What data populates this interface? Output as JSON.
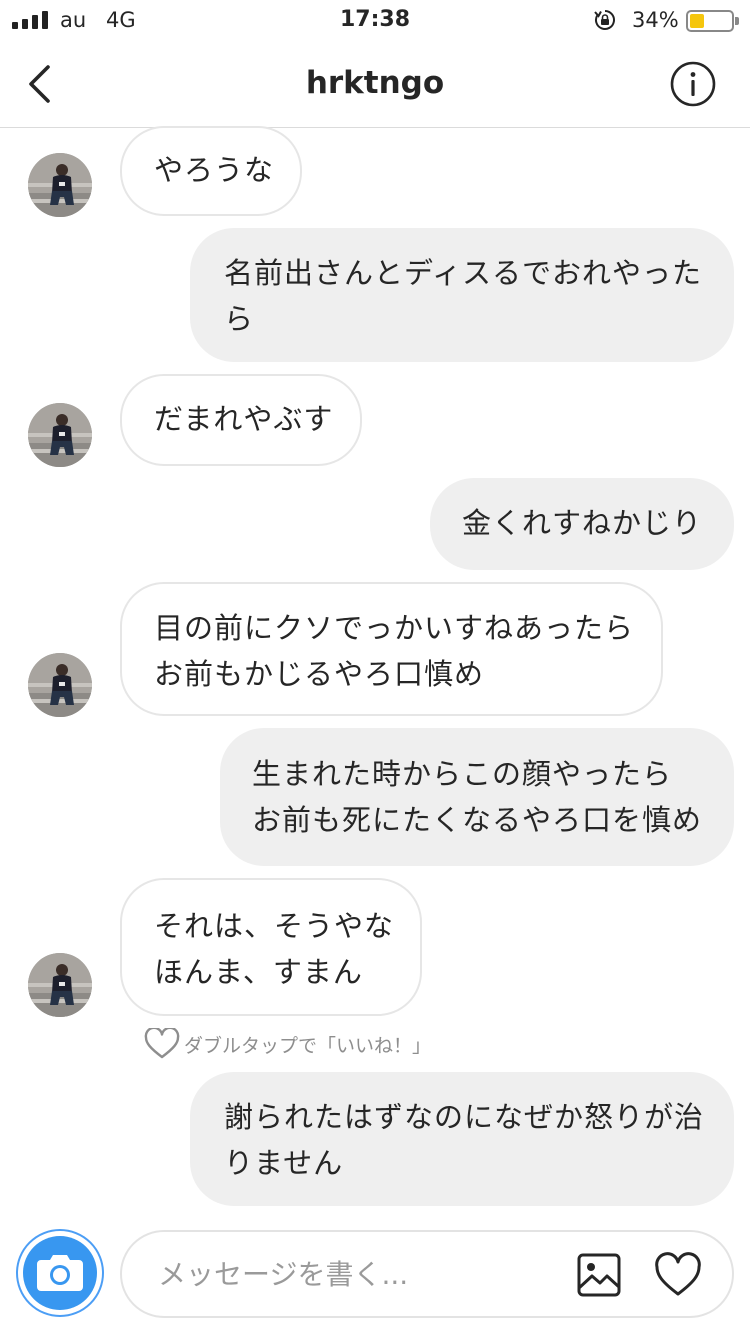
{
  "status_bar": {
    "carrier": "au",
    "network": "4G",
    "time": "17:38",
    "battery_percent": "34%",
    "battery_level": 0.34
  },
  "header": {
    "title": "hrktngo",
    "back_icon": "chevron-left-icon",
    "info_icon": "info-circle-icon"
  },
  "messages": [
    {
      "direction": "received",
      "text": "やろうな"
    },
    {
      "direction": "sent",
      "lines": [
        "名前出さんとディスるでおれやった",
        "ら"
      ]
    },
    {
      "direction": "received",
      "text": "だまれやぶす"
    },
    {
      "direction": "sent",
      "text": "金くれすねかじり"
    },
    {
      "direction": "received",
      "lines": [
        "目の前にクソでっかいすねあったら",
        "お前もかじるやろ口慎め"
      ]
    },
    {
      "direction": "sent",
      "lines": [
        "生まれた時からこの顔やったら",
        "お前も死にたくなるやろ口を慎め"
      ]
    },
    {
      "direction": "received",
      "lines": [
        "それは、そうやな",
        "ほんま、すまん"
      ]
    },
    {
      "direction": "sent",
      "lines": [
        "謝られたはずなのになぜか怒りが治",
        "りません"
      ]
    }
  ],
  "like_hint": "ダブルタップで「いいね！」",
  "composer": {
    "placeholder": "メッセージを書く...",
    "camera_icon": "camera-icon",
    "gallery_icon": "image-gallery-icon",
    "like_icon": "heart-outline-icon"
  },
  "colors": {
    "accent": "#3897f0",
    "sent_bubble": "#efefef",
    "received_border": "#e6e6e6"
  }
}
